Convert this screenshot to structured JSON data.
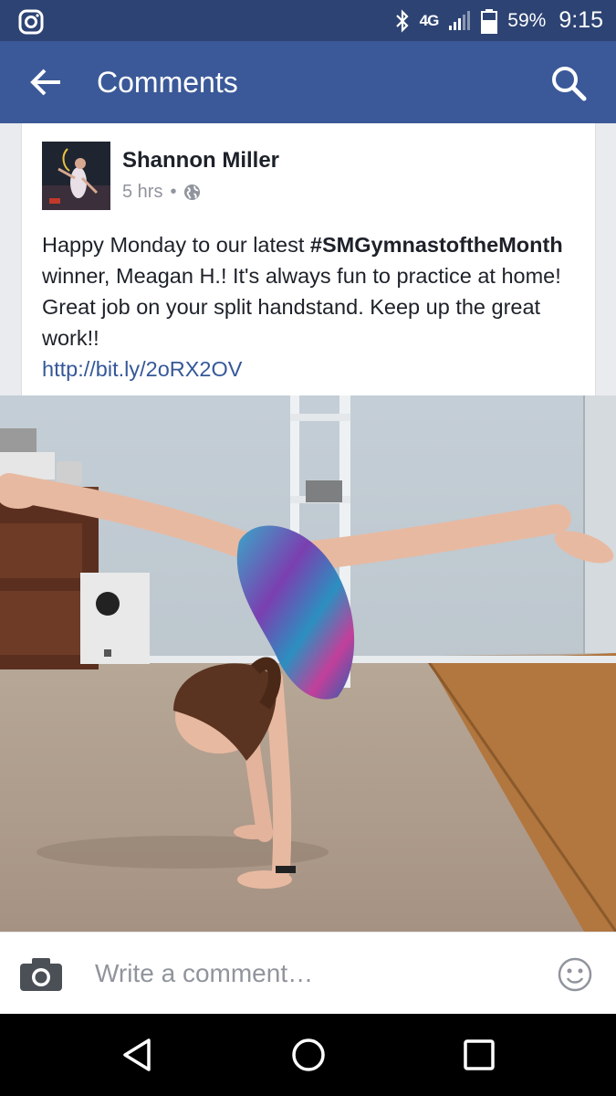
{
  "status_bar": {
    "network": "4G",
    "battery_percent": "59%",
    "time": "9:15"
  },
  "app_bar": {
    "title": "Comments"
  },
  "post": {
    "author": "Shannon Miller",
    "timestamp": "5 hrs",
    "separator": "•",
    "privacy_icon": "globe-icon",
    "text_before": "Happy Monday to our latest ",
    "hashtag": "#SMGymnastoftheMonth",
    "text_after": " winner, Meagan H.! It's always fun to practice at home! Great job on your split handstand. Keep up the great work!!",
    "link": "http://bit.ly/2oRX2OV"
  },
  "comment_bar": {
    "placeholder": "Write a comment…"
  },
  "icons": {
    "instagram": "instagram-icon",
    "bluetooth": "bluetooth-icon",
    "signal": "signal-icon",
    "battery": "battery-icon",
    "back": "back-arrow-icon",
    "search": "search-icon",
    "camera": "camera-icon",
    "emoji": "smiley-icon"
  },
  "colors": {
    "status_bar": "#2d4373",
    "app_bar": "#3b5998",
    "link": "#365899"
  }
}
